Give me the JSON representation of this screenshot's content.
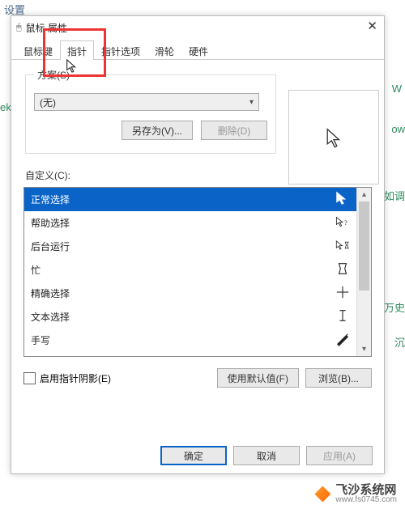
{
  "bg": {
    "t1": "设置",
    "t2": "W",
    "t3": "ek",
    "t4": "ow",
    "t5": "如调",
    "t6": "万史",
    "t7": "沉"
  },
  "window": {
    "title": "鼠标 属性"
  },
  "tabs": [
    "鼠标键",
    "指针",
    "指针选项",
    "滑轮",
    "硬件"
  ],
  "active_tab": 1,
  "scheme": {
    "legend": "方案(S)",
    "selected": "(无)",
    "save_as": "另存为(V)...",
    "delete": "删除(D)"
  },
  "custom_label": "自定义(C):",
  "list": [
    {
      "label": "正常选择",
      "icon": "arrow"
    },
    {
      "label": "帮助选择",
      "icon": "arrow-q"
    },
    {
      "label": "后台运行",
      "icon": "arrow-hg"
    },
    {
      "label": "忙",
      "icon": "hourglass"
    },
    {
      "label": "精确选择",
      "icon": "cross"
    },
    {
      "label": "文本选择",
      "icon": "ibeam"
    },
    {
      "label": "手写",
      "icon": "pen"
    }
  ],
  "selected_row": 0,
  "shadow": {
    "label": "启用指针阴影(E)"
  },
  "row_btns": {
    "defaults": "使用默认值(F)",
    "browse": "浏览(B)..."
  },
  "dlg_btns": {
    "ok": "确定",
    "cancel": "取消",
    "apply": "应用(A)"
  },
  "watermark": {
    "name": "飞沙系统网",
    "url": "www.fs0745.com"
  }
}
